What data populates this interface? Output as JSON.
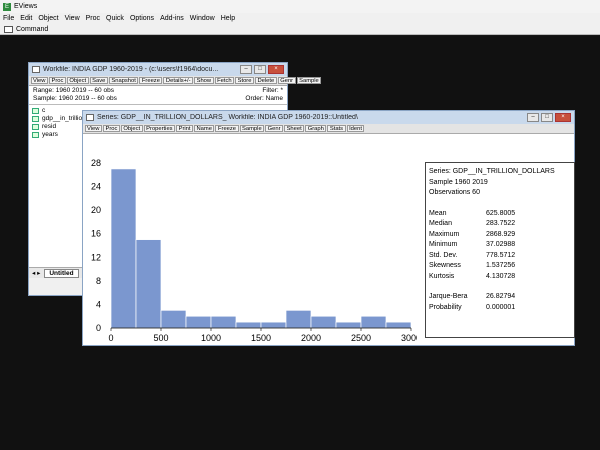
{
  "app": {
    "title": "EViews",
    "menu": [
      "File",
      "Edit",
      "Object",
      "View",
      "Proc",
      "Quick",
      "Options",
      "Add-ins",
      "Window",
      "Help"
    ],
    "command_label": "Command"
  },
  "workfile": {
    "title": "Workfile: INDIA GDP 1960-2019 - (c:\\users\\f1964\\docu...",
    "toolbar": [
      "View",
      "Proc",
      "Object",
      "Save",
      "Snapshot",
      "Freeze",
      "Details+/-",
      "Show",
      "Fetch",
      "Store",
      "Delete",
      "Genr",
      "Sample"
    ],
    "range_label": "Range:  1960 2019  --  60 obs",
    "filter_label": "Filter: *",
    "sample_label": "Sample: 1960 2019  --  60 obs",
    "order_label": "Order: Name",
    "objects": [
      "c",
      "gdp__in_trillion",
      "resid",
      "years"
    ],
    "tab_label": "Untitled"
  },
  "series": {
    "title": "Series: GDP__IN_TRILLION_DOLLARS_   Workfile: INDIA GDP 1960-2019::Untitled\\",
    "toolbar": [
      "View",
      "Proc",
      "Object",
      "Properties",
      "Print",
      "Name",
      "Freeze",
      "Sample",
      "Genr",
      "Sheet",
      "Graph",
      "Stats",
      "Ident"
    ],
    "stats_header": [
      "Series: GDP__IN_TRILLION_DOLLARS",
      "Sample 1960 2019",
      "Observations 60"
    ],
    "stats": [
      {
        "label": "Mean",
        "value": "625.8005"
      },
      {
        "label": "Median",
        "value": "283.7522"
      },
      {
        "label": "Maximum",
        "value": "2868.929"
      },
      {
        "label": "Minimum",
        "value": "37.02988"
      },
      {
        "label": "Std. Dev.",
        "value": "778.5712"
      },
      {
        "label": "Skewness",
        "value": "1.537256"
      },
      {
        "label": "Kurtosis",
        "value": "4.130728"
      }
    ],
    "stats2": [
      {
        "label": "Jarque-Bera",
        "value": "26.82794"
      },
      {
        "label": "Probability",
        "value": "0.000001"
      }
    ]
  },
  "colors": {
    "bar": "#7b97cf",
    "accent": "#2e8b3e"
  },
  "chart_data": {
    "type": "bar",
    "title": "",
    "xlabel": "",
    "ylabel": "",
    "bin_edges": [
      0,
      250,
      500,
      750,
      1000,
      1250,
      1500,
      1750,
      2000,
      2250,
      2500,
      2750,
      3000
    ],
    "values": [
      27,
      15,
      3,
      2,
      2,
      1,
      1,
      3,
      2,
      1,
      2,
      1
    ],
    "xlim": [
      0,
      3000
    ],
    "ylim": [
      0,
      28
    ],
    "xticks": [
      0,
      500,
      1000,
      1500,
      2000,
      2500,
      3000
    ],
    "yticks": [
      0,
      4,
      8,
      12,
      16,
      20,
      24,
      28
    ]
  }
}
